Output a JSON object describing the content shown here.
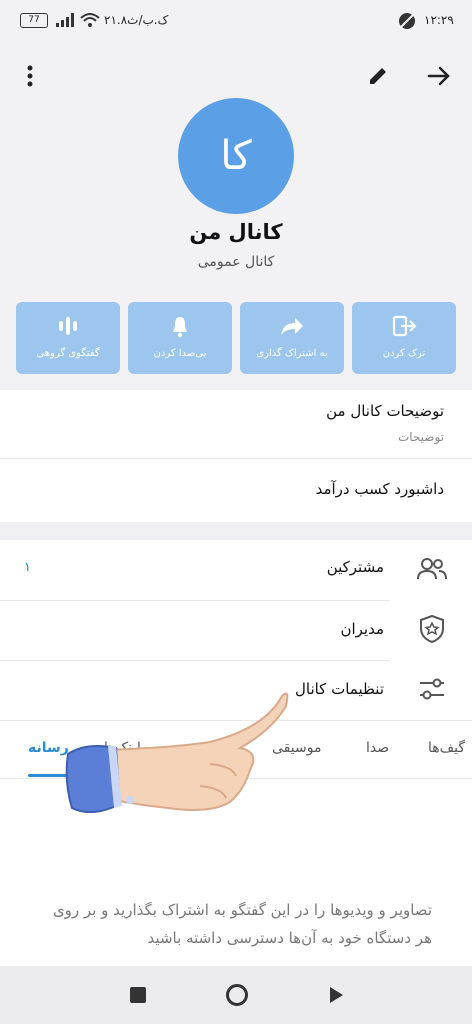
{
  "status_bar": {
    "time": "۱۲:۲۹",
    "speed": "۲۱.۸ک.ب/ث",
    "battery": "77"
  },
  "header": {
    "avatar_text": "کا",
    "channel_name": "کانال من",
    "channel_type": "کانال عمومی"
  },
  "actions": [
    {
      "label": "ترک کردن",
      "icon": "exit-icon"
    },
    {
      "label": "به اشتراک گذاری",
      "icon": "share-icon"
    },
    {
      "label": "بی‌صدا کردن",
      "icon": "bell-icon"
    },
    {
      "label": "گفتگوی گروهی",
      "icon": "voice-chat-icon"
    }
  ],
  "info": {
    "description_value": "توضیحات کانال من",
    "description_label": "توضیحات",
    "dashboard": "داشبورد کسب درآمد"
  },
  "menu": [
    {
      "label": "مشترکین",
      "value": "۱",
      "icon": "people-icon"
    },
    {
      "label": "مدیران",
      "icon": "shield-star-icon"
    },
    {
      "label": "تنظیمات کانال",
      "icon": "sliders-icon"
    }
  ],
  "media_tabs": {
    "items": [
      "رسانه",
      "لینک‌ها",
      "موسیقی",
      "صدا",
      "گیف‌ها"
    ],
    "active": "رسانه"
  },
  "empty_text": "تصاویر و ویدیوها را در این گفتگو به اشتراک بگذارید و بر روی هر دستگاه خود به آن‌ها دسترسی داشته باشید",
  "colors": {
    "accent": "#5b9fe6",
    "action_bg": "#9cc6ee",
    "tab_active": "#2a8bd8"
  }
}
